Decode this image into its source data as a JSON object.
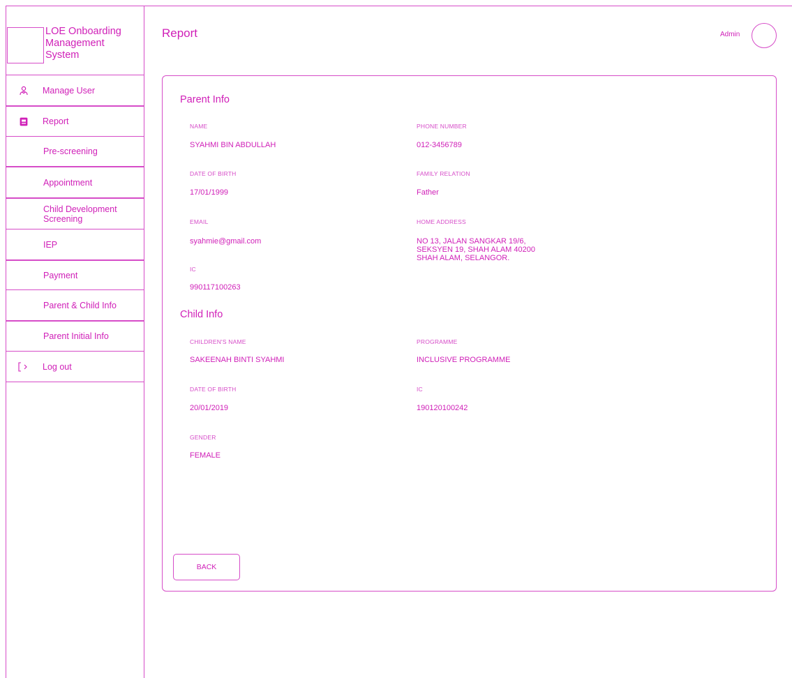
{
  "brand": {
    "name": "LOE Onboarding\nManagement\nSystem"
  },
  "sidebar": {
    "items": [
      {
        "label": "Manage User",
        "icon": "users-icon"
      },
      {
        "label": "Report",
        "icon": "report-icon"
      },
      {
        "label": "Pre-screening"
      },
      {
        "label": "Appointment"
      },
      {
        "label": "Child Development Screening"
      },
      {
        "label": "IEP"
      },
      {
        "label": "Payment"
      },
      {
        "label": "Parent & Child Info"
      },
      {
        "label": "Parent Initial Info"
      },
      {
        "label": "Log out",
        "icon": "logout-icon"
      }
    ]
  },
  "header": {
    "title": "Report",
    "user": "Admin"
  },
  "parent": {
    "section_title": "Parent Info",
    "name_label": "NAME",
    "name": "SYAHMI BIN ABDULLAH",
    "phone_label": "PHONE NUMBER",
    "phone": "012-3456789",
    "dob_label": "DATE OF BIRTH",
    "dob": "17/01/1999",
    "relation_label": "FAMILY RELATION",
    "relation": "Father",
    "email_label": "EMAIL",
    "email": "syahmie@gmail.com",
    "address_label": "HOME ADDRESS",
    "address": "NO 13, JALAN SANGKAR 19/6,\nSEKSYEN 19, SHAH ALAM 40200\nSHAH ALAM, SELANGOR.",
    "ic_label": "IC",
    "ic": "990117100263"
  },
  "child": {
    "section_title": "Child Info",
    "name_label": "CHILDREN'S NAME",
    "name": "SAKEENAH BINTI SYAHMI",
    "programme_label": "PROGRAMME",
    "programme": "INCLUSIVE PROGRAMME",
    "dob_label": "DATE OF BIRTH",
    "dob": "20/01/2019",
    "ic_label": "IC",
    "ic": "190120100242",
    "gender_label": "GENDER",
    "gender": "FEMALE"
  },
  "actions": {
    "back_label": "BACK"
  },
  "colors": {
    "accent": "#d020b8",
    "border": "#d64cc8",
    "background": "#ffffff"
  }
}
